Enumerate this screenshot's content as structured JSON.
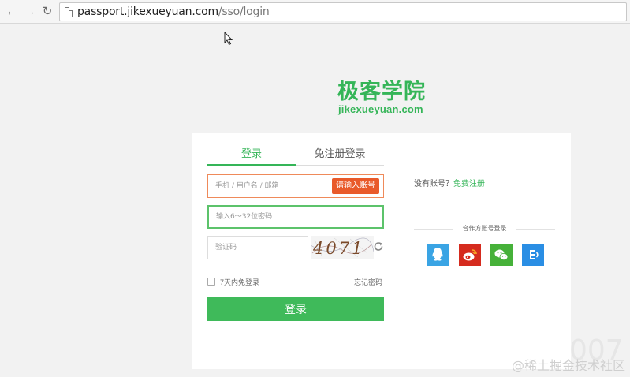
{
  "browser": {
    "url_domain": "passport.jikexueyuan.com",
    "url_path": "/sso/login"
  },
  "logo": {
    "name_cn": "极客学院",
    "name_en": "jikexueyuan.com",
    "color": "#35b558"
  },
  "login": {
    "tabs": [
      {
        "label": "登录",
        "active": true
      },
      {
        "label": "免注册登录",
        "active": false
      }
    ],
    "account_placeholder": "手机 / 用户名 / 邮箱",
    "account_error": "请输入账号",
    "password_placeholder": "输入6～32位密码",
    "captcha_placeholder": "验证码",
    "captcha_text": "4071",
    "remember_label": "7天内免登录",
    "forgot_label": "忘记密码",
    "submit_label": "登录",
    "no_account_text": "没有账号？",
    "register_label": "免费注册",
    "partner_title": "合作方账号登录",
    "partners": [
      "qq-icon",
      "weibo-icon",
      "wechat-icon",
      "ie-icon"
    ]
  },
  "watermark": "@稀土掘金技术社区",
  "watermark_num": "007"
}
